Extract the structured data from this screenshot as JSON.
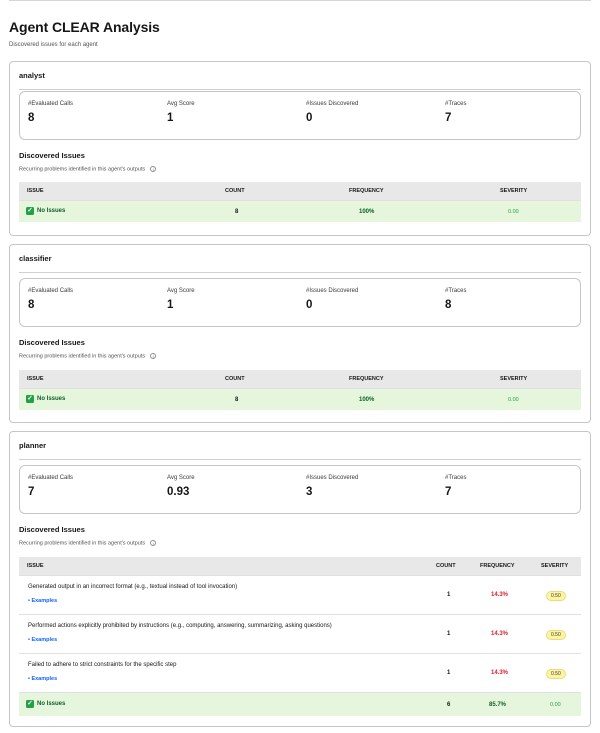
{
  "page": {
    "title": "Agent CLEAR Analysis",
    "subtitle": "Discovered issues for each agent"
  },
  "metric_labels": {
    "calls": "#Evaluated Calls",
    "score": "Avg Score",
    "issues": "#Issues Discovered",
    "traces": "#Traces"
  },
  "section": {
    "title": "Discovered Issues",
    "subtitle": "Recurring problems identified in this agent's outputs",
    "info_icon": "i"
  },
  "columns": {
    "issue": "ISSUE",
    "count": "COUNT",
    "frequency": "FREQUENCY",
    "severity": "SEVERITY"
  },
  "no_issues_label": "No Issues",
  "check_glyph": "✓",
  "examples_label": "• Examples",
  "agents": [
    {
      "name": "analyst",
      "metrics": {
        "calls": "8",
        "score": "1",
        "issues": "0",
        "traces": "7"
      },
      "no_issues": {
        "count": "8",
        "frequency": "100%",
        "severity": "0.00"
      }
    },
    {
      "name": "classifier",
      "metrics": {
        "calls": "8",
        "score": "1",
        "issues": "0",
        "traces": "8"
      },
      "no_issues": {
        "count": "8",
        "frequency": "100%",
        "severity": "0.00"
      }
    },
    {
      "name": "planner",
      "metrics": {
        "calls": "7",
        "score": "0.93",
        "issues": "3",
        "traces": "7"
      },
      "issues": [
        {
          "text": "Generated output in an incorrect format (e.g., textual instead of tool invocation)",
          "count": "1",
          "frequency": "14.3%",
          "severity": "0.50"
        },
        {
          "text": "Performed actions explicitly prohibited by instructions (e.g., computing, answering, summarizing, asking questions)",
          "count": "1",
          "frequency": "14.3%",
          "severity": "0.50"
        },
        {
          "text": "Failed to adhere to strict constraints for the specific step",
          "count": "1",
          "frequency": "14.3%",
          "severity": "0.50"
        }
      ],
      "no_issues": {
        "count": "6",
        "frequency": "85.7%",
        "severity": "0.00"
      }
    }
  ],
  "colors": {
    "ok_row_bg": "#e5f6dc",
    "ok_text": "#0e6027",
    "bad_freq": "#da1e28",
    "link": "#0f62fe",
    "severity_badge": "#fcf4a0"
  }
}
